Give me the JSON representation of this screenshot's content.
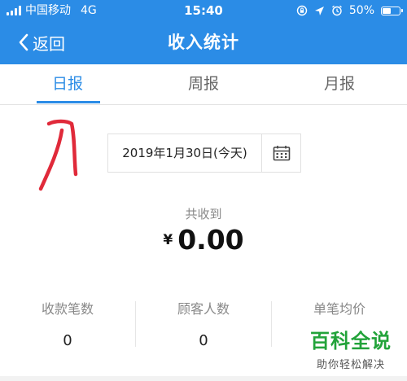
{
  "status_bar": {
    "carrier": "中国移动",
    "network": "4G",
    "time": "15:40",
    "battery_text": "50%",
    "battery_level": 0.5
  },
  "nav": {
    "back_label": "返回",
    "title": "收入统计"
  },
  "tabs": [
    {
      "label": "日报",
      "active": true
    },
    {
      "label": "周报",
      "active": false
    },
    {
      "label": "月报",
      "active": false
    }
  ],
  "date_picker": {
    "value": "2019年1月30日(今天)",
    "icon": "calendar-icon"
  },
  "summary": {
    "label": "共收到",
    "currency": "¥",
    "amount": "0.00"
  },
  "stats": [
    {
      "label": "收款笔数",
      "value": "0"
    },
    {
      "label": "顾客人数",
      "value": "0"
    },
    {
      "label": "单笔均价",
      "value": ""
    }
  ],
  "watermark": {
    "title": "百科全说",
    "subtitle": "助你轻松解决"
  },
  "colors": {
    "brand_blue": "#2b8ce6",
    "annotation_red": "#e02a3a",
    "watermark_green": "#22a33a"
  }
}
